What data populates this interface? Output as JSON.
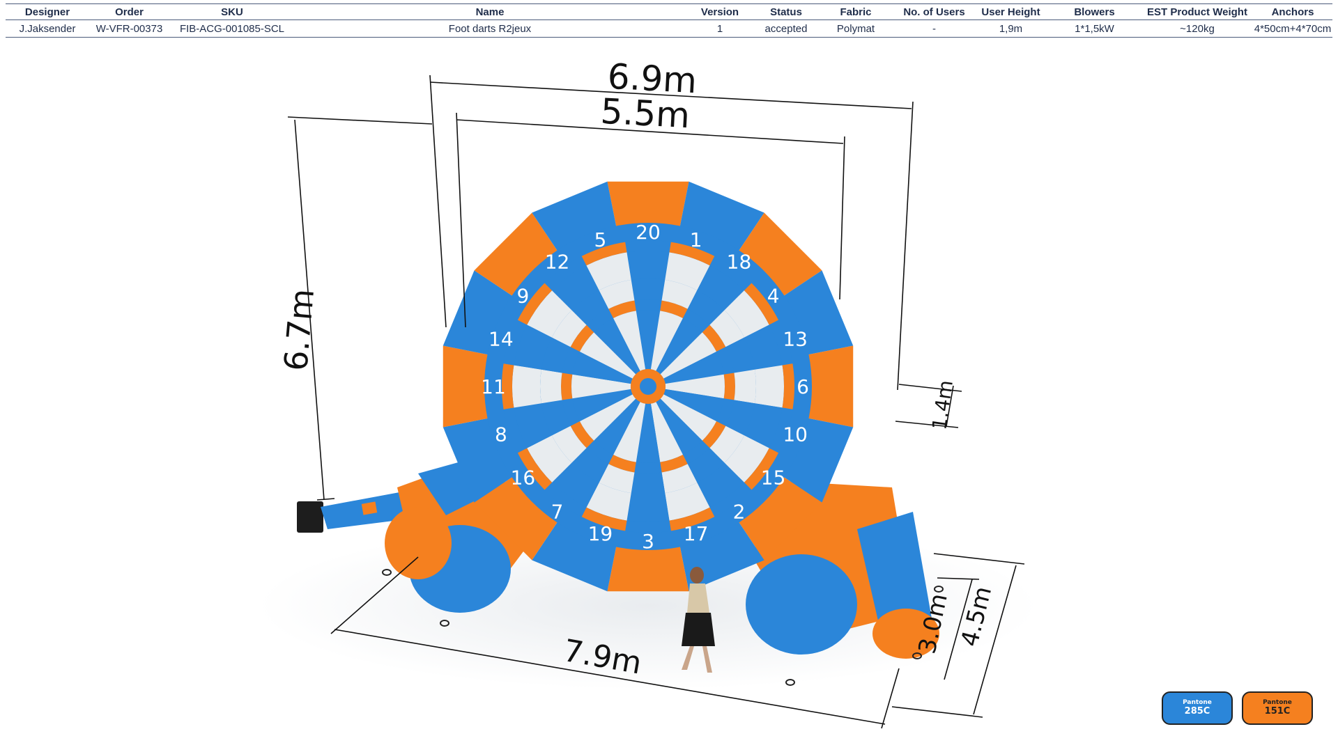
{
  "table": {
    "headers": [
      "Designer",
      "Order",
      "SKU",
      "Name",
      "Version",
      "Status",
      "Fabric",
      "No. of Users",
      "User  Height",
      "Blowers",
      "EST Product Weight",
      "Anchors"
    ],
    "row": [
      "J.Jaksender",
      "W-VFR-00373",
      "FIB-ACG-001085-SCL",
      "Foot darts R2jeux",
      "1",
      "accepted",
      "Polymat",
      "-",
      "1,9m",
      "1*1,5kW",
      "~120kg",
      "4*50cm+4*70cm"
    ]
  },
  "dimensions": {
    "outer_width": "6.9m",
    "inner_width": "5.5m",
    "height": "6.7m",
    "side_height": "1.4m",
    "base_length": "7.9m",
    "depth_inner": "3.0m",
    "depth_outer": "4.5m"
  },
  "dartboard": {
    "numbers": [
      "20",
      "1",
      "18",
      "4",
      "13",
      "6",
      "10",
      "15",
      "2",
      "17",
      "3",
      "19",
      "7",
      "16",
      "8",
      "11",
      "14",
      "9",
      "12",
      "5"
    ]
  },
  "swatches": [
    {
      "brand": "Pantone",
      "code": "285C",
      "color": "#2b86d9"
    },
    {
      "brand": "Pantone",
      "code": "151C",
      "color": "#f5801f"
    }
  ],
  "colors": {
    "blue": "#2b86d9",
    "orange": "#f5801f",
    "light": "#e8ecef"
  }
}
